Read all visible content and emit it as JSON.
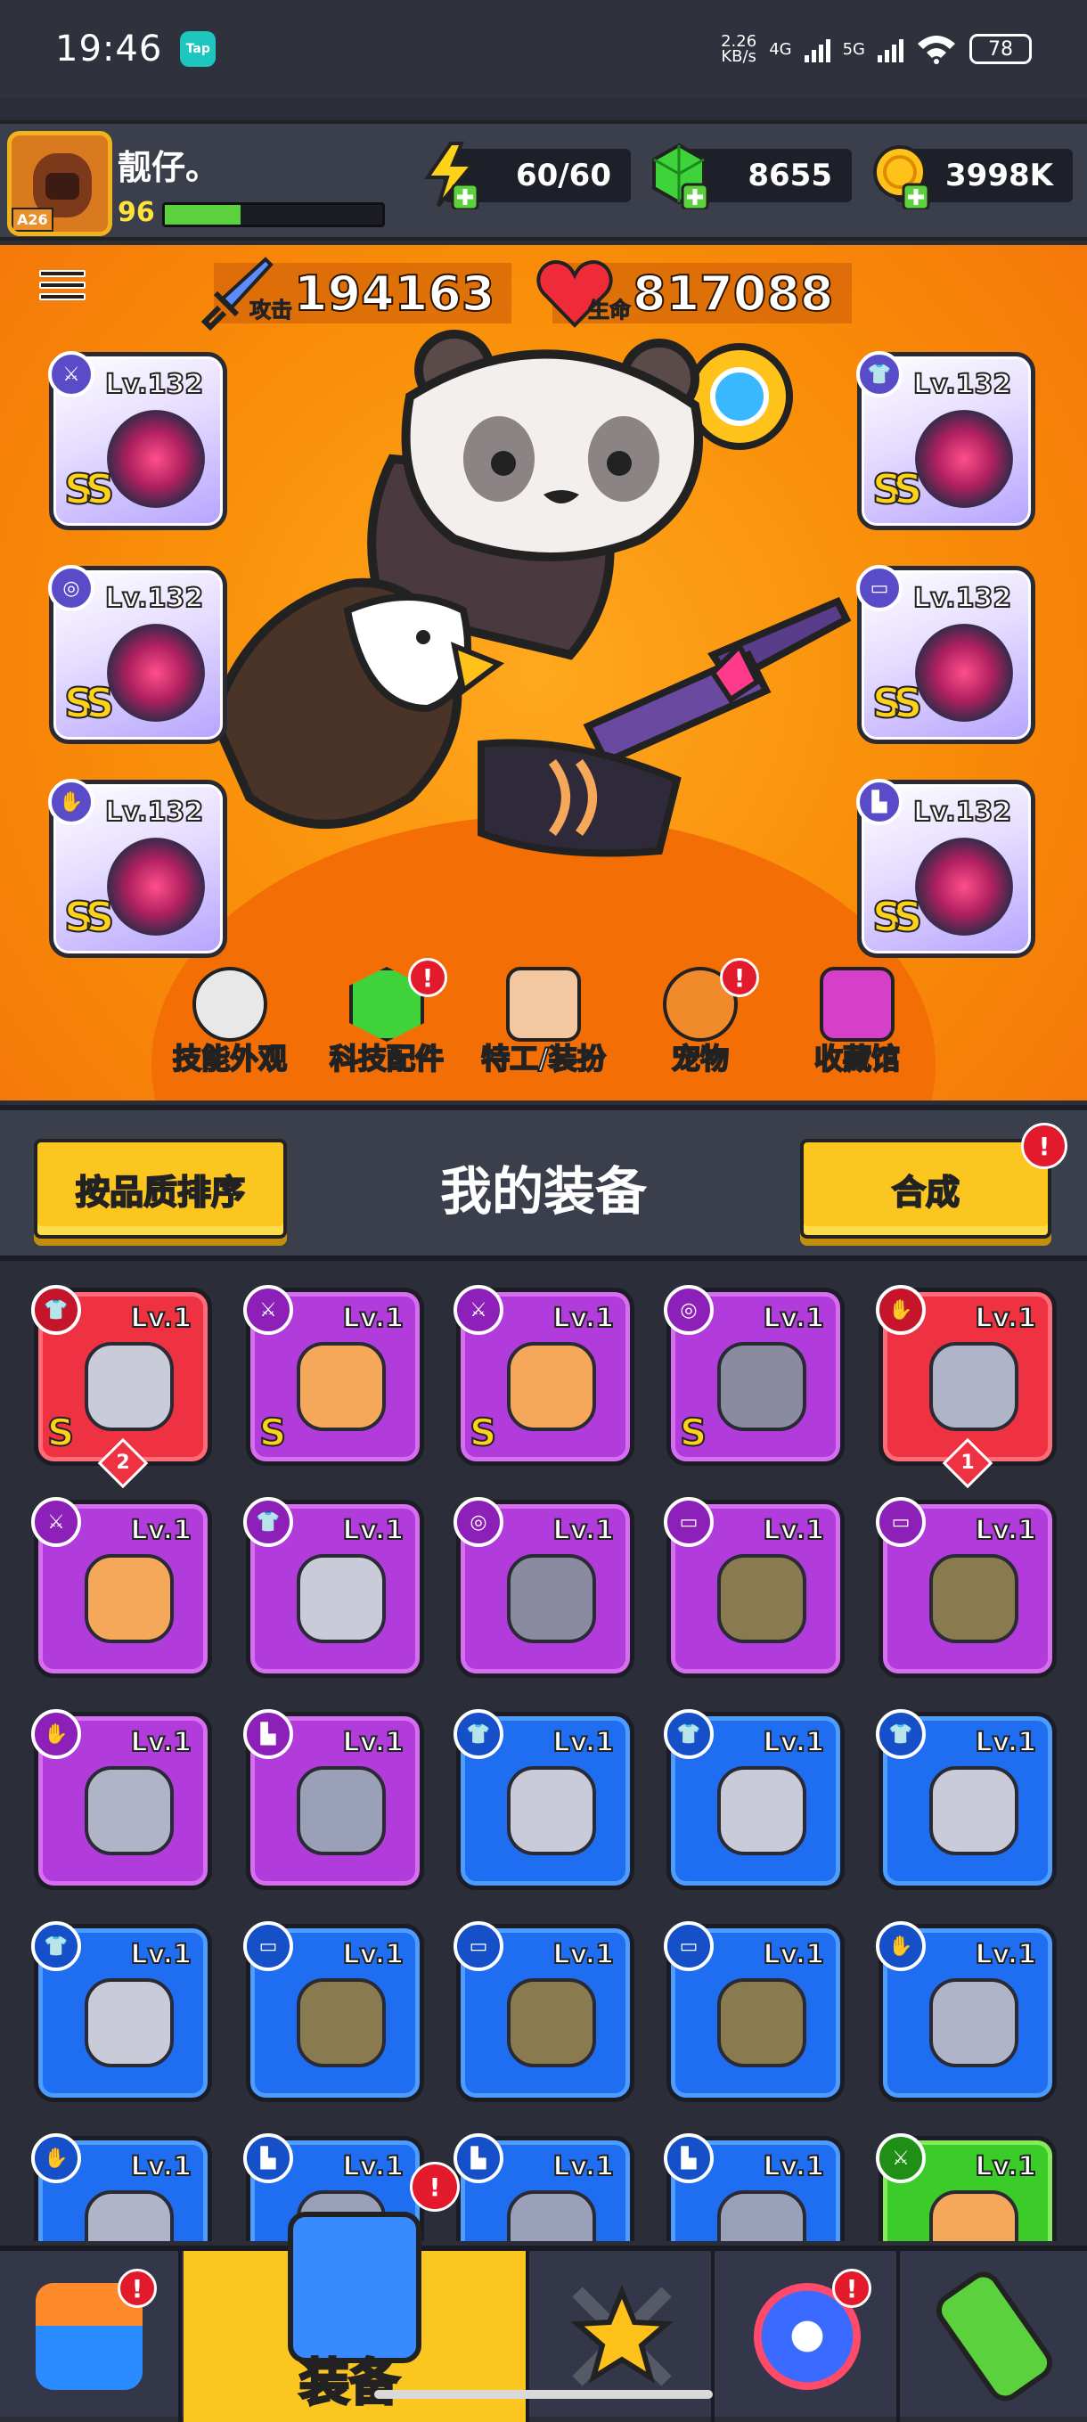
{
  "status_bar": {
    "time": "19:46",
    "tap_label": "Tap",
    "net_speed_top": "2.26",
    "net_speed_bottom": "KB/s",
    "net_4g": "4G",
    "net_5g": "5G",
    "battery": "78"
  },
  "player": {
    "name": "靓仔。",
    "level": "96",
    "avatar_tag": "A26",
    "xp_fraction": 0.35
  },
  "resources": {
    "energy": "60/60",
    "gems": "8655",
    "gold": "3998K"
  },
  "stats": {
    "attack_label": "攻击",
    "attack_value": "194163",
    "hp_label": "生命",
    "hp_value": "817088"
  },
  "equipped_slots": [
    {
      "slot": "weapon",
      "level": "Lv.132",
      "grade": "SS",
      "icon": "sword-slot-icon"
    },
    {
      "slot": "necklace",
      "level": "Lv.132",
      "grade": "SS",
      "icon": "necklace-slot-icon"
    },
    {
      "slot": "gloves",
      "level": "Lv.132",
      "grade": "SS",
      "icon": "glove-slot-icon"
    },
    {
      "slot": "armor",
      "level": "Lv.132",
      "grade": "SS",
      "icon": "shirt-slot-icon"
    },
    {
      "slot": "belt",
      "level": "Lv.132",
      "grade": "SS",
      "icon": "belt-slot-icon"
    },
    {
      "slot": "boots",
      "level": "Lv.132",
      "grade": "SS",
      "icon": "boot-slot-icon"
    }
  ],
  "feature_tabs": [
    {
      "label": "技能外观",
      "badge": ""
    },
    {
      "label": "科技配件",
      "badge": "!"
    },
    {
      "label": "特工/装扮",
      "badge": ""
    },
    {
      "label": "宠物",
      "badge": "!"
    },
    {
      "label": "收藏馆",
      "badge": ""
    }
  ],
  "gear_section": {
    "sort_button": "按品质排序",
    "title": "我的装备",
    "merge_button": "合成",
    "merge_badge": "!"
  },
  "inventory": [
    {
      "level": "Lv.1",
      "rarity": "red",
      "grade": "S",
      "count": "2",
      "slot": "armor"
    },
    {
      "level": "Lv.1",
      "rarity": "purple",
      "grade": "S",
      "count": "",
      "slot": "weapon"
    },
    {
      "level": "Lv.1",
      "rarity": "purple",
      "grade": "S",
      "count": "",
      "slot": "weapon"
    },
    {
      "level": "Lv.1",
      "rarity": "purple",
      "grade": "S",
      "count": "",
      "slot": "necklace"
    },
    {
      "level": "Lv.1",
      "rarity": "red",
      "grade": "",
      "count": "1",
      "slot": "gloves"
    },
    {
      "level": "Lv.1",
      "rarity": "purple",
      "grade": "",
      "count": "",
      "slot": "weapon"
    },
    {
      "level": "Lv.1",
      "rarity": "purple",
      "grade": "",
      "count": "",
      "slot": "armor"
    },
    {
      "level": "Lv.1",
      "rarity": "purple",
      "grade": "",
      "count": "",
      "slot": "necklace"
    },
    {
      "level": "Lv.1",
      "rarity": "purple",
      "grade": "",
      "count": "",
      "slot": "belt"
    },
    {
      "level": "Lv.1",
      "rarity": "purple",
      "grade": "",
      "count": "",
      "slot": "belt"
    },
    {
      "level": "Lv.1",
      "rarity": "purple",
      "grade": "",
      "count": "",
      "slot": "gloves"
    },
    {
      "level": "Lv.1",
      "rarity": "purple",
      "grade": "",
      "count": "",
      "slot": "boots"
    },
    {
      "level": "Lv.1",
      "rarity": "blue",
      "grade": "",
      "count": "",
      "slot": "armor"
    },
    {
      "level": "Lv.1",
      "rarity": "blue",
      "grade": "",
      "count": "",
      "slot": "armor"
    },
    {
      "level": "Lv.1",
      "rarity": "blue",
      "grade": "",
      "count": "",
      "slot": "armor"
    },
    {
      "level": "Lv.1",
      "rarity": "blue",
      "grade": "",
      "count": "",
      "slot": "armor"
    },
    {
      "level": "Lv.1",
      "rarity": "blue",
      "grade": "",
      "count": "",
      "slot": "belt"
    },
    {
      "level": "Lv.1",
      "rarity": "blue",
      "grade": "",
      "count": "",
      "slot": "belt"
    },
    {
      "level": "Lv.1",
      "rarity": "blue",
      "grade": "",
      "count": "",
      "slot": "belt"
    },
    {
      "level": "Lv.1",
      "rarity": "blue",
      "grade": "",
      "count": "",
      "slot": "gloves"
    },
    {
      "level": "Lv.1",
      "rarity": "blue",
      "grade": "",
      "count": "",
      "slot": "gloves"
    },
    {
      "level": "Lv.1",
      "rarity": "blue",
      "grade": "",
      "count": "",
      "slot": "boots"
    },
    {
      "level": "Lv.1",
      "rarity": "blue",
      "grade": "",
      "count": "",
      "slot": "boots"
    },
    {
      "level": "Lv.1",
      "rarity": "blue",
      "grade": "",
      "count": "",
      "slot": "boots"
    },
    {
      "level": "Lv.1",
      "rarity": "green",
      "grade": "",
      "count": "",
      "slot": "weapon"
    }
  ],
  "bottom_nav": [
    {
      "name": "shop",
      "label": "",
      "badge": "!"
    },
    {
      "name": "equipment",
      "label": "装备",
      "badge": "!"
    },
    {
      "name": "battle",
      "label": "",
      "badge": ""
    },
    {
      "name": "talents",
      "label": "",
      "badge": "!"
    },
    {
      "name": "evolution",
      "label": "",
      "badge": ""
    }
  ],
  "colors": {
    "hero_bg": "#f98e08",
    "rarity_red": "#ef3241",
    "rarity_purple": "#b23bdb",
    "rarity_blue": "#1f6df0",
    "rarity_green": "#3ccc2a",
    "button_yellow": "#fcc620",
    "badge_red": "#e3192c"
  }
}
